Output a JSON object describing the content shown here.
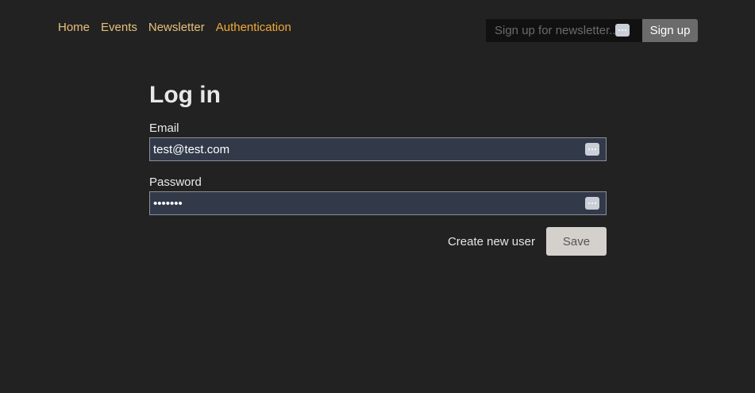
{
  "nav": {
    "items": [
      {
        "label": "Home"
      },
      {
        "label": "Events"
      },
      {
        "label": "Newsletter"
      },
      {
        "label": "Authentication",
        "active": true
      }
    ]
  },
  "newsletter": {
    "placeholder": "Sign up for newsletter...",
    "value": "",
    "button_label": "Sign up",
    "autofill_icon": "more-dots-icon"
  },
  "login": {
    "title": "Log in",
    "email": {
      "label": "Email",
      "value": "test@test.com",
      "autofill_icon": "more-dots-icon"
    },
    "password": {
      "label": "Password",
      "value": "1234567",
      "autofill_icon": "more-dots-icon"
    },
    "create_user_label": "Create new user",
    "save_label": "Save"
  },
  "colors": {
    "background": "#222222",
    "nav_link": "#e8c07a",
    "nav_link_active": "#f0a93a",
    "input_background": "#323a4a",
    "save_button": "#d4d1cd",
    "signup_button": "#6b6b6b"
  }
}
